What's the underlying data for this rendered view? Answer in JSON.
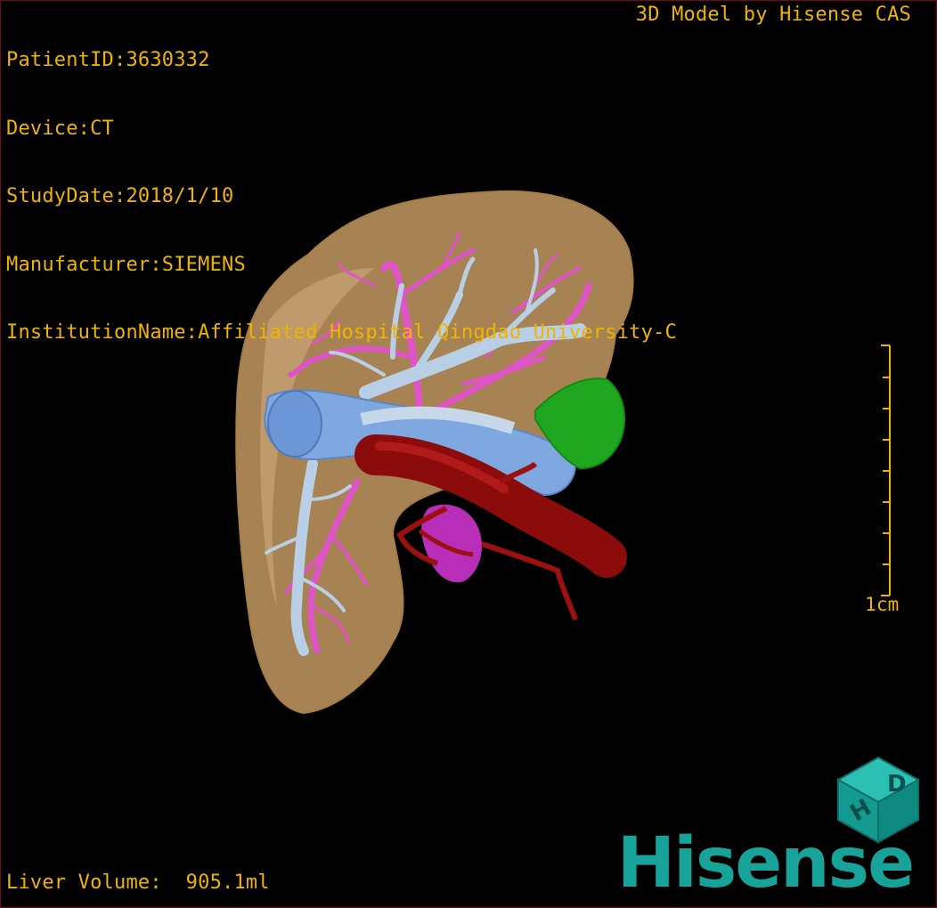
{
  "patient": {
    "patient_id": "PatientID:3630332",
    "device": "Device:CT",
    "study_date": "StudyDate:2018/1/10",
    "manufacturer": "Manufacturer:SIEMENS",
    "institution": "InstitutionName:Affiliated Hospital Qingdao University-C"
  },
  "credit": "3D Model by Hisense CAS",
  "volume": "Liver Volume:  905.1ml",
  "scale": {
    "label": "1cm"
  },
  "logo": {
    "text": "Hisense",
    "cube_letters": "HD"
  },
  "colors": {
    "hud_text": "#f0b400",
    "liver": "#c49a63",
    "portal_vein": "#e054c8",
    "hepatic_vein": "#b8cfe6",
    "vena_cava": "#7fa8e0",
    "aorta": "#8c0b0b",
    "gallbladder": "#1fa81f",
    "lesion": "#cc33cc",
    "brand": "#17a39a"
  },
  "structures": [
    "liver",
    "portal-vein",
    "hepatic-vein",
    "inferior-vena-cava",
    "artery",
    "gallbladder",
    "lesion"
  ]
}
